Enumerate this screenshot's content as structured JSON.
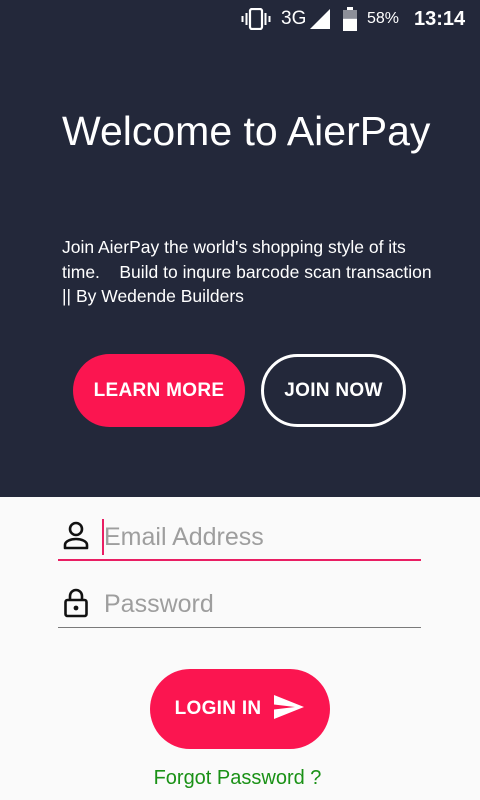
{
  "status_bar": {
    "network": "3G",
    "battery_percent": "58%",
    "battery_level": 0.58,
    "time": "13:14",
    "icons": [
      "vibrate-icon",
      "signal-icon",
      "battery-icon"
    ]
  },
  "hero": {
    "title": "Welcome to AierPay",
    "description": "Join AierPay the world's shopping style of its time.    Build to inqure barcode scan transaction || By Wedende Builders",
    "learn_more_label": "LEARN MORE",
    "join_now_label": "JOIN NOW"
  },
  "login_form": {
    "email": {
      "value": "",
      "placeholder": "Email Address",
      "icon": "person-icon"
    },
    "password": {
      "value": "",
      "placeholder": "Password",
      "icon": "lock-icon"
    },
    "login_label": "LOGIN IN",
    "login_icon": "send-icon",
    "forgot_label": "Forgot Password ?"
  },
  "colors": {
    "hero_background": "#23283a",
    "accent": "#fb1550",
    "focus_underline": "#e91e63",
    "link": "#1a9116",
    "page_background": "#fafafa"
  }
}
